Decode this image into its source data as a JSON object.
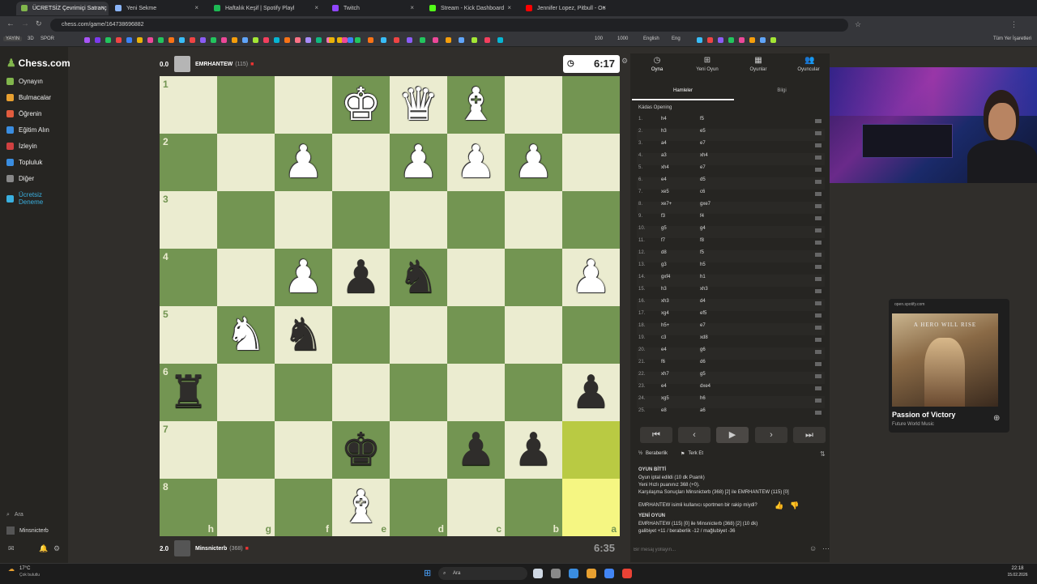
{
  "browser": {
    "tabs": [
      {
        "label": "ÜCRETSİZ Çevrimiçi Satranç Oy",
        "color": "#81b64c",
        "active": true
      },
      {
        "label": "Yeni Sekme",
        "color": "#8ab4f8",
        "active": false
      },
      {
        "label": "Haftalık Keşif | Spotify Playl",
        "color": "#1db954",
        "active": false,
        "badge": "YAYIN"
      },
      {
        "label": "Twitch",
        "color": "#9146ff",
        "active": false
      },
      {
        "label": "Stream - Kick Dashboard",
        "color": "#53fc18",
        "active": false
      },
      {
        "label": "Jennifer Lopez, Pitbull - On",
        "color": "#ff0000",
        "active": false
      }
    ],
    "url": "chess.com/game/164738696882",
    "bookmarks_left": [
      "YAYIN",
      "3D",
      "SPOR"
    ],
    "bookmarks_mid": [
      "100",
      "1000",
      "English",
      "Eng"
    ],
    "bookmarks_right": "Tüm Yer İşaretleri"
  },
  "nav": {
    "logo": "Chess.com",
    "items": [
      "Oynayın",
      "Bulmacalar",
      "Öğrenin",
      "Eğitim Alın",
      "İzleyin",
      "Topluluk",
      "Diğer",
      "Ücretsiz Deneme"
    ],
    "search": "Ara",
    "user": "Minsnicterb"
  },
  "top_player": {
    "name": "EMRHANTEW",
    "rating": "(115)",
    "score": "0.0",
    "clock": "6:17"
  },
  "bottom_player": {
    "name": "Minsnicterb",
    "rating": "(368)",
    "score": "2.0",
    "clock": "6:35"
  },
  "board": {
    "ranks": [
      "1",
      "2",
      "3",
      "4",
      "5",
      "6",
      "7",
      "8"
    ],
    "files": [
      "h",
      "g",
      "f",
      "e",
      "d",
      "c",
      "b",
      "a"
    ],
    "highlight": [
      [
        6,
        7
      ],
      [
        7,
        7
      ]
    ],
    "pieces": [
      {
        "r": 0,
        "c": 3,
        "p": "♚",
        "color": "w"
      },
      {
        "r": 0,
        "c": 4,
        "p": "♛",
        "color": "w"
      },
      {
        "r": 0,
        "c": 5,
        "p": "♝",
        "color": "w"
      },
      {
        "r": 1,
        "c": 2,
        "p": "♟",
        "color": "w"
      },
      {
        "r": 1,
        "c": 4,
        "p": "♟",
        "color": "w"
      },
      {
        "r": 1,
        "c": 5,
        "p": "♟",
        "color": "w"
      },
      {
        "r": 1,
        "c": 6,
        "p": "♟",
        "color": "w"
      },
      {
        "r": 3,
        "c": 2,
        "p": "♟",
        "color": "w"
      },
      {
        "r": 3,
        "c": 3,
        "p": "♟",
        "color": "b"
      },
      {
        "r": 3,
        "c": 4,
        "p": "♞",
        "color": "b"
      },
      {
        "r": 3,
        "c": 7,
        "p": "♟",
        "color": "w"
      },
      {
        "r": 4,
        "c": 1,
        "p": "♞",
        "color": "w"
      },
      {
        "r": 4,
        "c": 2,
        "p": "♞",
        "color": "b"
      },
      {
        "r": 5,
        "c": 0,
        "p": "♜",
        "color": "b"
      },
      {
        "r": 5,
        "c": 7,
        "p": "♟",
        "color": "b"
      },
      {
        "r": 6,
        "c": 3,
        "p": "♚",
        "color": "b"
      },
      {
        "r": 6,
        "c": 5,
        "p": "♟",
        "color": "b"
      },
      {
        "r": 6,
        "c": 6,
        "p": "♟",
        "color": "b"
      },
      {
        "r": 7,
        "c": 3,
        "p": "♝",
        "color": "w"
      }
    ]
  },
  "panel": {
    "tabs": [
      "Oyna",
      "Yeni Oyun",
      "Oyunlar",
      "Oyuncular"
    ],
    "subtabs": [
      "Hamleler",
      "Bilgi"
    ],
    "opening": "Kádas Opening",
    "moves": [
      [
        "1.",
        "h4",
        "f5"
      ],
      [
        "2.",
        "h3",
        "e5"
      ],
      [
        "3.",
        "a4",
        "e7"
      ],
      [
        "4.",
        "a3",
        "xh4"
      ],
      [
        "5.",
        "xh4",
        "e7"
      ],
      [
        "6.",
        "e4",
        "d5"
      ],
      [
        "7.",
        "xe5",
        "c6"
      ],
      [
        "8.",
        "xe7+",
        "gxe7"
      ],
      [
        "9.",
        "f3",
        "f4"
      ],
      [
        "10.",
        "g5",
        "g4"
      ],
      [
        "11.",
        "f7",
        "f8"
      ],
      [
        "12.",
        "d8",
        "f5"
      ],
      [
        "13.",
        "g3",
        "h5"
      ],
      [
        "14.",
        "gxf4",
        "h1"
      ],
      [
        "15.",
        "h3",
        "xh3"
      ],
      [
        "16.",
        "xh3",
        "d4"
      ],
      [
        "17.",
        "xg4",
        "ef5"
      ],
      [
        "18.",
        "h5+",
        "e7"
      ],
      [
        "19.",
        "c3",
        "xd8"
      ],
      [
        "20.",
        "e4",
        "g6"
      ],
      [
        "21.",
        "f6",
        "d6"
      ],
      [
        "22.",
        "xh7",
        "g5"
      ],
      [
        "23.",
        "e4",
        "dxe4"
      ],
      [
        "24.",
        "xg5",
        "h6"
      ],
      [
        "25.",
        "e8",
        "a6"
      ]
    ],
    "buttons": {
      "draw": "Beraberlik",
      "resign": "Terk Et"
    },
    "game_over": {
      "title": "OYUN BİTTİ",
      "lines": [
        "Oyun iptal edildi (10 dk Puanlı)",
        "Yeni Hızlı puanınız 368 (+0).",
        "Karşılaşma Sonuçları Minsnicterb (368) [2] ile EMRHANTEW (115) [0]",
        "EMRHANTEW isimli kullanıcı sportmen bir rakip miydi?"
      ]
    },
    "new_game": {
      "title": "YENİ OYUN",
      "lines": [
        "EMRHANTEW (115) [0] ile Minsnicterb (368) [2] (10 dk)",
        "galibiyet +11 / beraberlik -12 / mağlubiyet -36"
      ]
    },
    "chat_placeholder": "Bir mesaj yollayın..."
  },
  "spotify": {
    "source": "open.spotify.com",
    "album_text": "A HERO WILL RISE",
    "title": "Passion of Victory",
    "artist": "Future World Music"
  },
  "taskbar": {
    "weather": "17°C",
    "weather_desc": "Çok bulutlu",
    "search": "Ara",
    "time": "22:18",
    "date": "15.02.2026"
  }
}
